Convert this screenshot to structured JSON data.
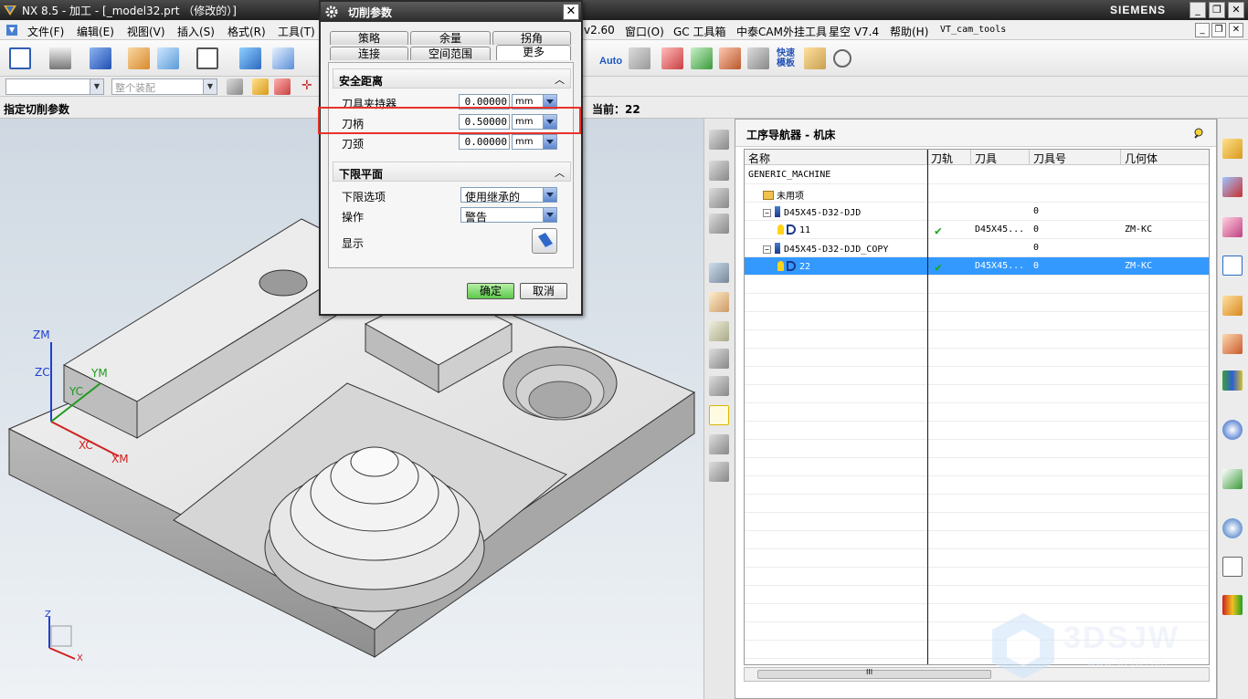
{
  "window": {
    "title": "NX 8.5 - 加工 - [_model32.prt （修改的）]",
    "brand": "SIEMENS",
    "min": "_",
    "restore": "❐",
    "close": "✕"
  },
  "menubar": {
    "items": [
      "文件(F)",
      "编辑(E)",
      "视图(V)",
      "插入(S)",
      "格式(R)",
      "工具(T)",
      "v2.60",
      "窗口(O)",
      "GC 工具箱",
      "中泰CAM外挂工具",
      "星空 V7.4",
      "帮助(H)",
      "VT_cam_tools"
    ]
  },
  "toolbar": {
    "auto_label": "Auto",
    "quick_template_label": "快速\n模板"
  },
  "toolbar2": {
    "filter_combo": "",
    "assembly_combo": "整个装配"
  },
  "cuebar": {
    "cue": "指定切削参数",
    "current": "当前：22"
  },
  "viewport": {
    "triad_labels": {
      "zm": "ZM",
      "zc": "ZC",
      "ym": "YM",
      "yc": "YC",
      "xc": "XC",
      "xm": "XM"
    },
    "mini_triad": {
      "z": "Z",
      "x": "X"
    }
  },
  "dialog": {
    "title": "切削参数",
    "close": "✕",
    "tabs_row1": [
      "策略",
      "余量",
      "拐角"
    ],
    "tabs_row2": [
      "连接",
      "空间范围",
      "更多"
    ],
    "active_tab": "更多",
    "group_safety": "安全距离",
    "group_lower": "下限平面",
    "caret": "︿",
    "fields": {
      "holder": {
        "label": "刀具夹持器",
        "value": "0.00000",
        "unit": "mm"
      },
      "shank": {
        "label": "刀柄",
        "value": "0.50000",
        "unit": "mm"
      },
      "neck": {
        "label": "刀颈",
        "value": "0.00000",
        "unit": "mm"
      }
    },
    "lower_option": {
      "label": "下限选项",
      "value": "使用继承的"
    },
    "action": {
      "label": "操作",
      "value": "警告"
    },
    "display": {
      "label": "显示"
    },
    "ok": "确定",
    "cancel": "取消"
  },
  "navigator": {
    "title": "工序导航器 - 机床",
    "columns": [
      "名称",
      "刀轨",
      "刀具",
      "刀具号",
      "几何体"
    ],
    "rows": [
      {
        "name": "GENERIC_MACHINE",
        "path": "",
        "tool": "",
        "number": "",
        "geometry": "",
        "indent": 0,
        "kind": "root"
      },
      {
        "name": "未用项",
        "path": "",
        "tool": "",
        "number": "",
        "geometry": "",
        "indent": 1,
        "kind": "folder"
      },
      {
        "name": "D45X45-D32-DJD",
        "path": "",
        "tool": "",
        "number": "0",
        "geometry": "",
        "indent": 1,
        "kind": "tool"
      },
      {
        "name": "11",
        "path": "✔",
        "tool": "D45X45...",
        "number": "0",
        "geometry": "ZM-KC",
        "indent": 2,
        "kind": "op"
      },
      {
        "name": "D45X45-D32-DJD_COPY",
        "path": "",
        "tool": "",
        "number": "0",
        "geometry": "",
        "indent": 1,
        "kind": "tool"
      },
      {
        "name": "22",
        "path": "✔",
        "tool": "D45X45...",
        "number": "0",
        "geometry": "ZM-KC",
        "indent": 2,
        "kind": "op",
        "selected": true
      }
    ],
    "scroll_thumb_label": "III"
  },
  "watermark": {
    "text": "3DSJW",
    "url": "www.3dsjw.com"
  },
  "colors": {
    "selection": "#3399ff",
    "highlight_box": "#e8322b",
    "ok_button": "#5ec84b",
    "check": "#17a917"
  }
}
